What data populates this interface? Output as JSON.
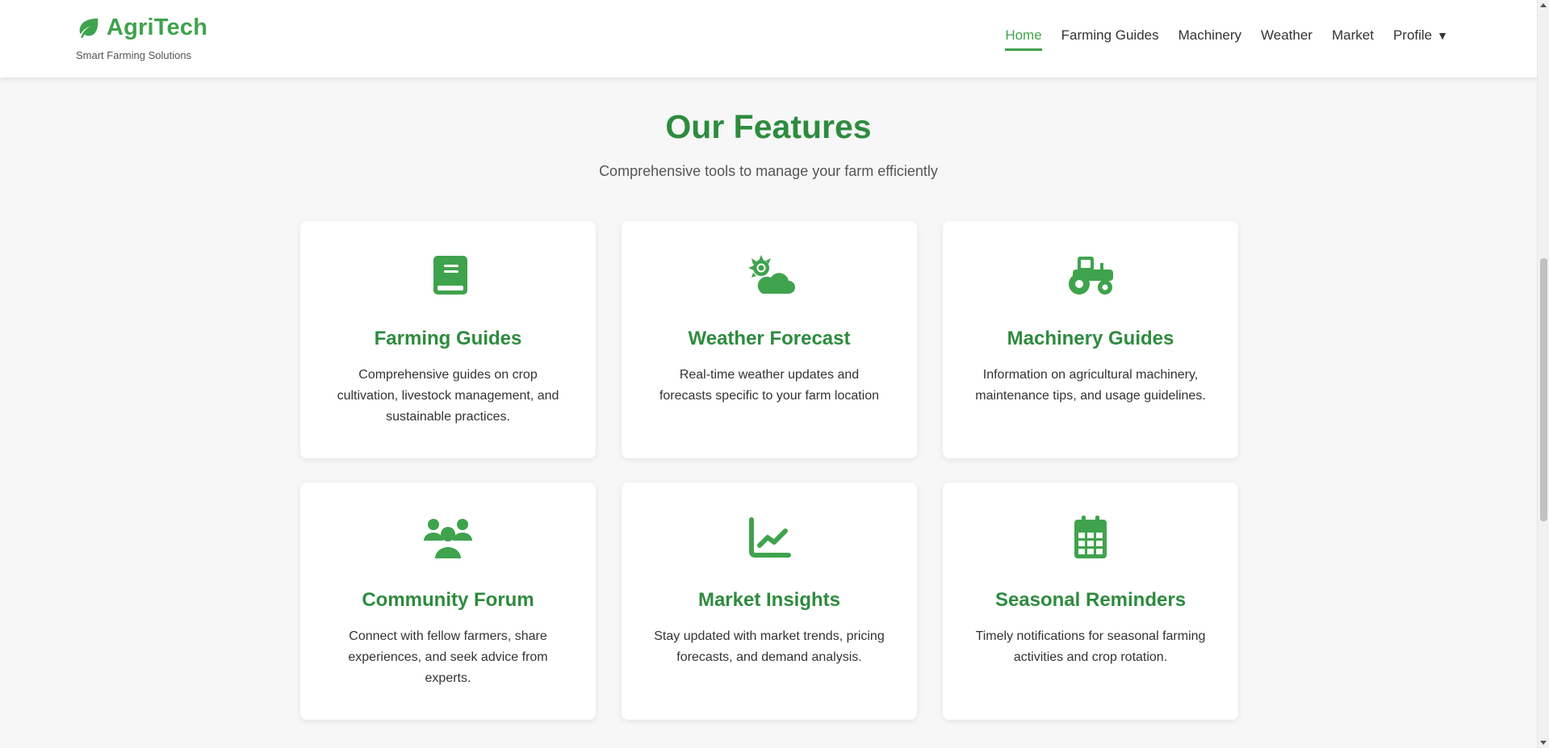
{
  "brand": {
    "name": "AgriTech",
    "tagline": "Smart Farming Solutions",
    "logo_icon": "leaf-icon",
    "accent_color": "#3fa34d"
  },
  "nav": {
    "items": [
      {
        "label": "Home",
        "active": true
      },
      {
        "label": "Farming Guides"
      },
      {
        "label": "Machinery"
      },
      {
        "label": "Weather"
      },
      {
        "label": "Market"
      },
      {
        "label": "Profile",
        "dropdown_indicator": "▼"
      }
    ]
  },
  "features": {
    "title": "Our Features",
    "subtitle": "Comprehensive tools to manage your farm efficiently",
    "title_color": "#2e8b3e",
    "cards": [
      {
        "icon": "book-icon",
        "title": "Farming Guides",
        "description": "Comprehensive guides on crop cultivation, livestock management, and sustainable practices."
      },
      {
        "icon": "sun-cloud-icon",
        "title": "Weather Forecast",
        "description": "Real-time weather updates and forecasts specific to your farm location"
      },
      {
        "icon": "tractor-icon",
        "title": "Machinery Guides",
        "description": "Information on agricultural machinery, maintenance tips, and usage guidelines."
      },
      {
        "icon": "users-icon",
        "title": "Community Forum",
        "description": "Connect with fellow farmers, share experiences, and seek advice from experts."
      },
      {
        "icon": "chart-line-icon",
        "title": "Market Insights",
        "description": "Stay updated with market trends, pricing forecasts, and demand analysis."
      },
      {
        "icon": "calendar-icon",
        "title": "Seasonal Reminders",
        "description": "Timely notifications for seasonal farming activities and crop rotation."
      }
    ]
  }
}
